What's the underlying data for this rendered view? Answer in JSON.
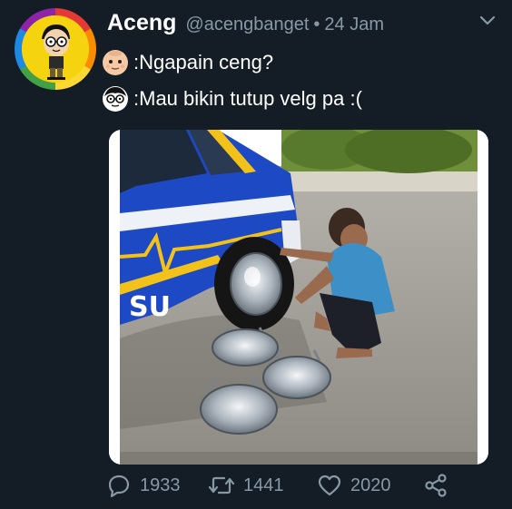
{
  "tweet": {
    "display_name": "Aceng",
    "handle": "@acengbanget",
    "separator": "•",
    "time": "24 Jam",
    "lines": [
      {
        "emoji": "baby-face-emoji",
        "text": ":Ngapain ceng?"
      },
      {
        "emoji": "nerd-face-emoji",
        "text": ":Mau bikin tutup velg pa :("
      }
    ],
    "image": {
      "description_icon": "photo-car-wheel-woks",
      "car_lettering": "SU"
    }
  },
  "actions": {
    "replies": "1933",
    "retweets": "1441",
    "likes": "2020"
  },
  "colors": {
    "background": "#141d26",
    "secondary_text": "#8899a6",
    "primary_text": "#ffffff",
    "car_blue": "#1e49c4",
    "car_stripe": "#f2c21b"
  }
}
